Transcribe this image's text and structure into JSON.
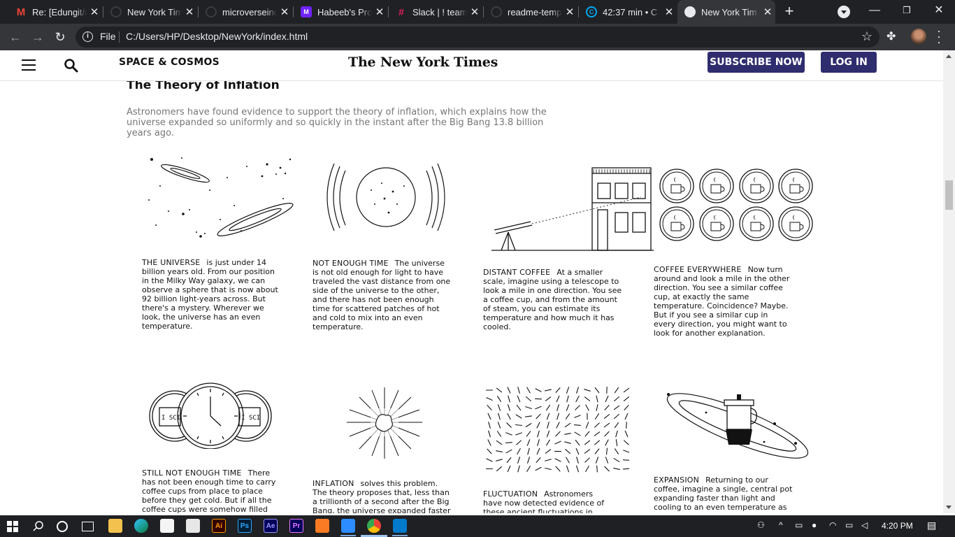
{
  "browser": {
    "tabs": [
      {
        "title": "Re: [Edungit/r",
        "icon": "gmail-icon"
      },
      {
        "title": "New York Tim",
        "icon": "github-icon"
      },
      {
        "title": "microverseinc",
        "icon": "github-icon"
      },
      {
        "title": "Habeeb's Proj",
        "icon": "microverse-icon"
      },
      {
        "title": "Slack | ! team",
        "icon": "slack-icon"
      },
      {
        "title": "readme-temp",
        "icon": "github-icon"
      },
      {
        "title": "42:37 min • C",
        "icon": "clockify-icon"
      },
      {
        "title": "New York Tim",
        "icon": "globe-icon"
      }
    ],
    "active_tab_index": 7,
    "address": {
      "scheme": "File",
      "url": "C:/Users/HP/Desktop/NewYork/index.html"
    }
  },
  "page": {
    "header": {
      "section": "SPACE & COSMOS",
      "masthead": "The New York Times",
      "subscribe_label": "SUBSCRIBE NOW",
      "login_label": "LOG IN"
    },
    "title": "The Theory of Inflation",
    "lede": "Astronomers have found evidence to support the theory of inflation, which explains how the universe expanded so uniformly and so quickly in the instant after the Big Bang 13.8 billion years ago.",
    "panels": [
      {
        "label": "THE UNIVERSE",
        "text": "is just under 14 billion years old. From our position in the Milky Way galaxy, we can observe a sphere that is now about 92 billion light-years across. But there's a mystery. Wherever we look, the universe has an even temperature.",
        "illustration": "galaxies-illustration"
      },
      {
        "label": "NOT ENOUGH TIME",
        "text": "The universe is not old enough for light to have traveled the vast distance from one side of the universe to the other, and there has not been enough time for scattered patches of hot and cold to mix into an even temperature.",
        "illustration": "observable-sphere-illustration"
      },
      {
        "label": "DISTANT COFFEE",
        "text": "At a smaller scale, imagine using a telescope to look a mile in one direction. You see a coffee cup, and from the amount of steam, you can estimate its temperature and how much it has cooled.",
        "illustration": "telescope-building-illustration"
      },
      {
        "label": "COFFEE EVERYWHERE",
        "text": "Now turn around and look a mile in the other direction. You see a similar coffee cup, at exactly the same temperature. Coincidence? Maybe. But if you see a similar cup in every direction, you might want to look for another explanation.",
        "illustration": "coffee-cups-grid-illustration"
      },
      {
        "label": "STILL NOT ENOUGH TIME",
        "text": "There has not been enough time to carry coffee cups from place to place before they get cold. But if all the coffee cups were somehow filled from a single coffee",
        "illustration": "clock-mugs-illustration"
      },
      {
        "label": "INFLATION",
        "text": "solves this problem. The theory proposes that, less than a trillionth of a second after the Big Bang, the universe expanded faster than the",
        "illustration": "burst-illustration"
      },
      {
        "label": "FLUCTUATION",
        "text": "Astronomers have now detected evidence of these ancient fluctuations in swirls of",
        "illustration": "fluctuation-field-illustration"
      },
      {
        "label": "EXPANSION",
        "text": "Returning to our coffee, imagine a single, central pot expanding faster than light and cooling to an even temperature as it expands. That is",
        "illustration": "coffee-pot-orbit-illustration"
      }
    ],
    "mug_text": "I SCI"
  },
  "taskbar": {
    "time": "4:20 PM",
    "apps": [
      "file-explorer-icon",
      "edge-icon",
      "store-icon",
      "mail-icon",
      "illustrator-icon",
      "photoshop-icon",
      "after-effects-icon",
      "premiere-icon",
      "xampp-icon",
      "zoom-icon",
      "chrome-icon",
      "vscode-icon"
    ],
    "app_labels": {
      "illustrator": "Ai",
      "photoshop": "Ps",
      "after_effects": "Ae",
      "premiere": "Pr"
    }
  }
}
